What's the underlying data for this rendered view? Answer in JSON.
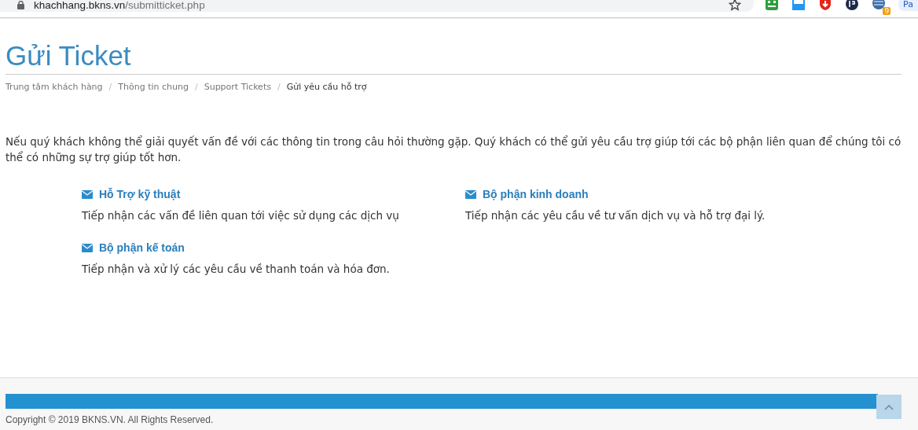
{
  "browser": {
    "url_host": "khachhang.bkns.vn",
    "url_path": "/submitticket.php",
    "extension_badge": "9",
    "profile_label": "Pa"
  },
  "page": {
    "title": "Gửi Ticket"
  },
  "breadcrumb": [
    {
      "label": "Trung tâm khách hàng",
      "current": false
    },
    {
      "label": "Thông tin chung",
      "current": false
    },
    {
      "label": "Support Tickets",
      "current": false
    },
    {
      "label": "Gửi yêu cầu hỗ trợ",
      "current": true
    }
  ],
  "breadcrumb_separator": "/",
  "intro": "Nếu quý khách không thể giải quyết vấn đề với các thông tin trong câu hỏi thường gặp. Quý khách có thể gửi yêu cầu trợ giúp tới các bộ phận liên quan để chúng tôi có thể có những sự trợ giúp tốt hơn.",
  "departments": [
    {
      "name": "Hỗ Trợ kỹ thuật",
      "description": "Tiếp nhận các vấn đề liên quan tới việc sử dụng các dịch vụ"
    },
    {
      "name": "Bộ phận kinh doanh",
      "description": "Tiếp nhận các yêu cầu về tư vấn dịch vụ và hỗ trợ đại lý."
    },
    {
      "name": "Bộ phận kế toán",
      "description": "Tiếp nhận và xử lý các yêu cầu về thanh toán và hóa đơn."
    }
  ],
  "footer": {
    "copyright": "Copyright © 2019 BKNS.VN. All Rights Reserved."
  }
}
